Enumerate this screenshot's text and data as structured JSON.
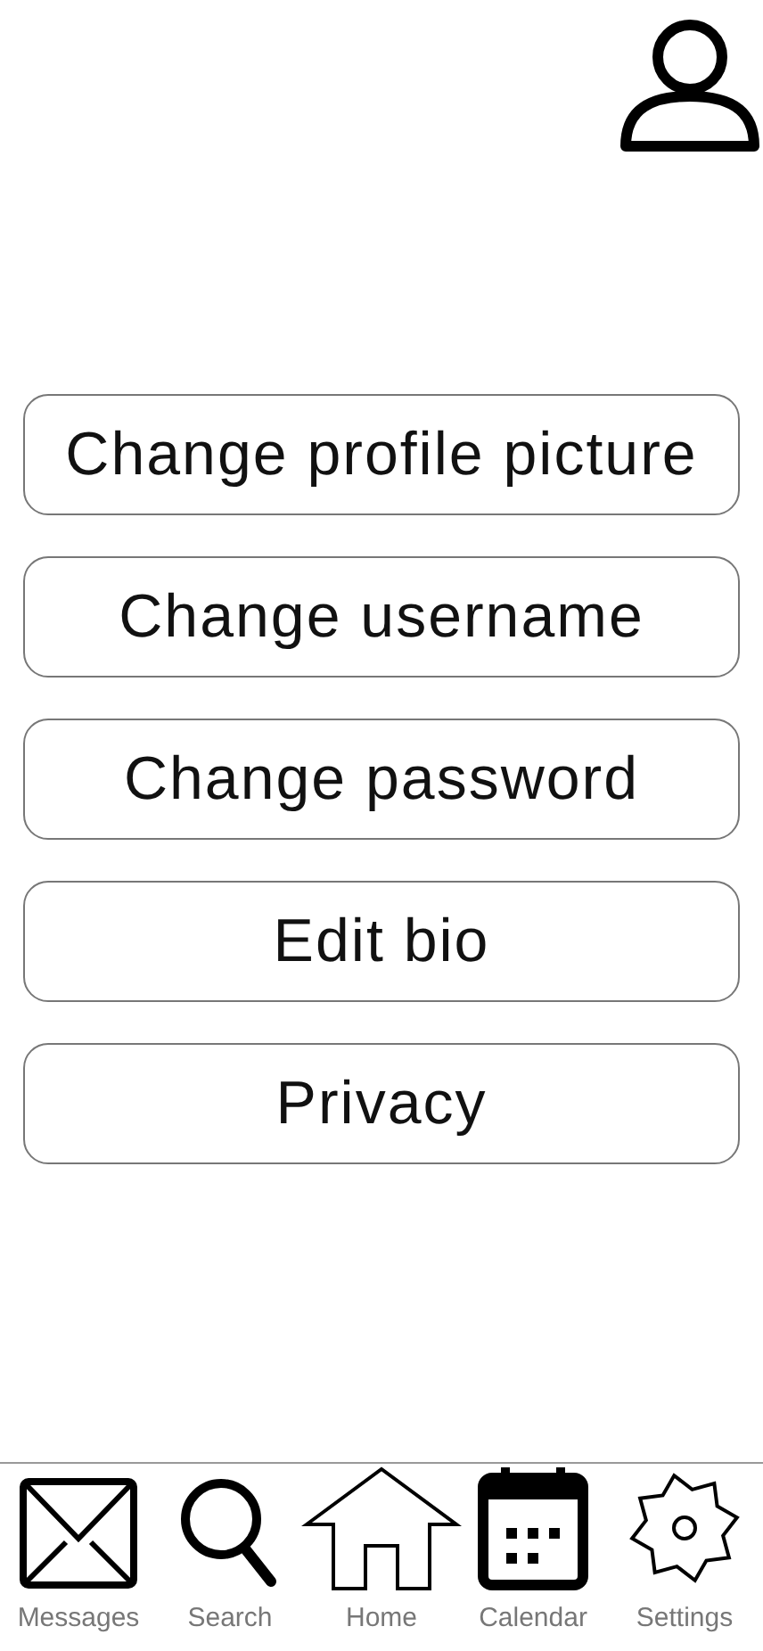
{
  "menu": [
    {
      "label": "Change profile picture"
    },
    {
      "label": "Change username"
    },
    {
      "label": "Change password"
    },
    {
      "label": "Edit bio"
    },
    {
      "label": "Privacy"
    }
  ],
  "nav": [
    {
      "kind": "messages",
      "label": "Messages"
    },
    {
      "kind": "search",
      "label": "Search"
    },
    {
      "kind": "home",
      "label": "Home"
    },
    {
      "kind": "calendar",
      "label": "Calendar"
    },
    {
      "kind": "settings",
      "label": "Settings"
    }
  ]
}
